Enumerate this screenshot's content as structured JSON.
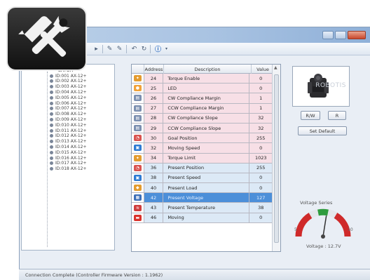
{
  "toolbar": {
    "icons": [
      "forward-icon",
      "pencil-icon",
      "pencil-icon",
      "undo-icon",
      "refresh-icon",
      "info-icon"
    ]
  },
  "tree": {
    "root_label": "LATOR",
    "items": [
      "ID:001 AX-12+",
      "ID:002 AX-12+",
      "ID:003 AX-12+",
      "ID:004 AX-12+",
      "ID:005 AX-12+",
      "ID:006 AX-12+",
      "ID:007 AX-12+",
      "ID:008 AX-12+",
      "ID:009 AX-12+",
      "ID:010 AX-12+",
      "ID:011 AX-12+",
      "ID:012 AX-12+",
      "ID:013 AX-12+",
      "ID:014 AX-12+",
      "ID:015 AX-12+",
      "ID:016 AX-12+",
      "ID:017 AX-12+",
      "ID:018 AX-12+"
    ]
  },
  "table": {
    "headers": {
      "address": "Address",
      "description": "Description",
      "value": "Value"
    },
    "rows": [
      {
        "address": "24",
        "description": "Torque Enable",
        "value": "0",
        "tone": "pink",
        "icon": "torque-icon",
        "icon_color": "#e39b2f"
      },
      {
        "address": "25",
        "description": "LED",
        "value": "0",
        "tone": "pink",
        "icon": "led-icon",
        "icon_color": "#f0a23a"
      },
      {
        "address": "26",
        "description": "CW Compliance Margin",
        "value": "1",
        "tone": "pink",
        "icon": "chart-icon",
        "icon_color": "#7b8fb0"
      },
      {
        "address": "27",
        "description": "CCW Compliance Margin",
        "value": "1",
        "tone": "pink",
        "icon": "chart-icon",
        "icon_color": "#7b8fb0"
      },
      {
        "address": "28",
        "description": "CW Compliance Slope",
        "value": "32",
        "tone": "pink",
        "icon": "chart-icon",
        "icon_color": "#7b8fb0"
      },
      {
        "address": "29",
        "description": "CCW Compliance Slope",
        "value": "32",
        "tone": "pink",
        "icon": "chart-icon",
        "icon_color": "#7b8fb0"
      },
      {
        "address": "30",
        "description": "Goal Position",
        "value": "255",
        "tone": "pink",
        "icon": "position-icon",
        "icon_color": "#d9534f"
      },
      {
        "address": "32",
        "description": "Moving Speed",
        "value": "0",
        "tone": "pink",
        "icon": "speed-icon",
        "icon_color": "#2f7bd3"
      },
      {
        "address": "34",
        "description": "Torque Limit",
        "value": "1023",
        "tone": "pink",
        "icon": "torque-icon",
        "icon_color": "#e39b2f"
      },
      {
        "address": "36",
        "description": "Present Position",
        "value": "255",
        "tone": "blue",
        "icon": "position-icon",
        "icon_color": "#d9534f"
      },
      {
        "address": "38",
        "description": "Present Speed",
        "value": "0",
        "tone": "blue",
        "icon": "speed-icon",
        "icon_color": "#2f7bd3"
      },
      {
        "address": "40",
        "description": "Present Load",
        "value": "0",
        "tone": "blue",
        "icon": "load-icon",
        "icon_color": "#e39b2f"
      },
      {
        "address": "42",
        "description": "Present Voltage",
        "value": "127",
        "tone": "sel",
        "icon": "voltage-icon",
        "icon_color": "#3d6fb8"
      },
      {
        "address": "43",
        "description": "Present Temperature",
        "value": "38",
        "tone": "blue",
        "icon": "temperature-icon",
        "icon_color": "#cf3c3c"
      },
      {
        "address": "46",
        "description": "Moving",
        "value": "0",
        "tone": "blue",
        "icon": "moving-icon",
        "icon_color": "#d9322c"
      }
    ]
  },
  "device": {
    "watermark": "ROBOTIS"
  },
  "buttons": {
    "rw": "R/W",
    "r": "R",
    "set_default": "Set Default"
  },
  "gauge": {
    "label": "Voltage Series",
    "voltage_text": "Voltage : 12.7V",
    "level": 0.55
  },
  "status": {
    "text": "Connection Complete (Controller Firmware Version : 1.1962)"
  }
}
